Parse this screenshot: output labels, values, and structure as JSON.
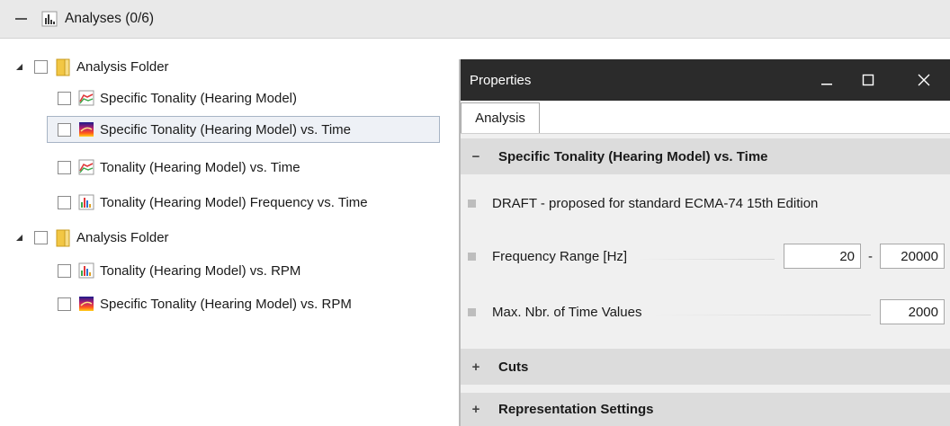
{
  "group": {
    "title": "Analyses (0/6)"
  },
  "tree": [
    {
      "kind": "folder",
      "label": "Analysis Folder",
      "expanded": true
    },
    {
      "kind": "item",
      "icon": "line-chart-icon",
      "label": "Specific Tonality (Hearing Model)"
    },
    {
      "kind": "item",
      "icon": "spectrogram-icon",
      "label": "Specific Tonality (Hearing Model) vs. Time",
      "selected": true
    },
    {
      "kind": "item",
      "icon": "line-chart-icon",
      "label": "Tonality (Hearing Model) vs. Time"
    },
    {
      "kind": "item",
      "icon": "bar-chart-icon",
      "label": "Tonality (Hearing Model) Frequency vs. Time"
    },
    {
      "kind": "folder",
      "label": "Analysis Folder",
      "expanded": true
    },
    {
      "kind": "item",
      "icon": "bar-chart-icon",
      "label": "Tonality (Hearing Model) vs. RPM"
    },
    {
      "kind": "item",
      "icon": "spectrogram-icon",
      "label": "Specific Tonality (Hearing Model) vs. RPM"
    }
  ],
  "properties": {
    "title": "Properties",
    "tab": "Analysis",
    "section_main": {
      "symbol": "−",
      "title": "Specific Tonality (Hearing Model) vs. Time"
    },
    "draft_note": "DRAFT - proposed for standard ECMA-74 15th Edition",
    "freq_range": {
      "label": "Frequency Range [Hz]",
      "from": "20",
      "separator": "-",
      "to": "20000"
    },
    "max_time": {
      "label": "Max. Nbr. of Time Values",
      "value": "2000"
    },
    "section_cuts": {
      "symbol": "+",
      "title": "Cuts"
    },
    "section_repr": {
      "symbol": "+",
      "title": "Representation Settings"
    }
  },
  "colors": {
    "titlebar": "#2b2b2b",
    "section_header": "#dcdcdc",
    "selection_border": "#a7b4c5",
    "folder": "#f2c744"
  }
}
